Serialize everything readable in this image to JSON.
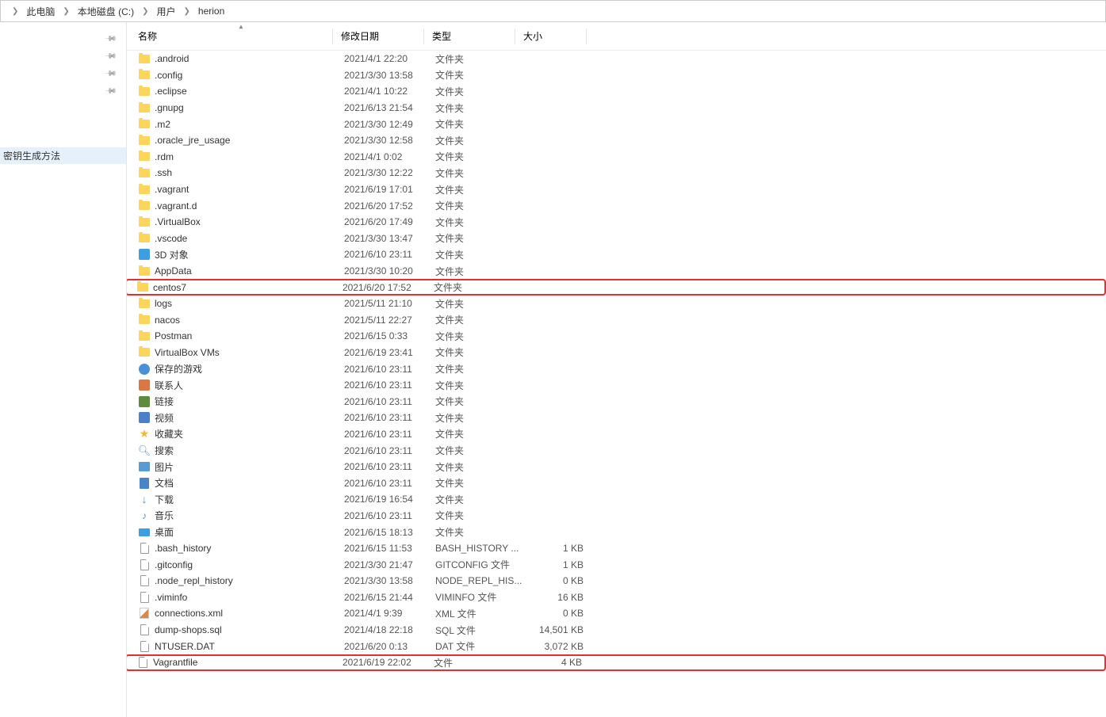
{
  "breadcrumb": [
    {
      "label": "此电脑"
    },
    {
      "label": "本地磁盘 (C:)"
    },
    {
      "label": "用户"
    },
    {
      "label": "herion"
    }
  ],
  "nav": {
    "pinned_count": 4,
    "selected_item": "密钥生成方法"
  },
  "columns": {
    "name": "名称",
    "date": "修改日期",
    "type": "类型",
    "size": "大小"
  },
  "files": [
    {
      "icon": "folder",
      "name": ".android",
      "date": "2021/4/1 22:20",
      "type": "文件夹",
      "size": ""
    },
    {
      "icon": "folder",
      "name": ".config",
      "date": "2021/3/30 13:58",
      "type": "文件夹",
      "size": ""
    },
    {
      "icon": "folder",
      "name": ".eclipse",
      "date": "2021/4/1 10:22",
      "type": "文件夹",
      "size": ""
    },
    {
      "icon": "folder",
      "name": ".gnupg",
      "date": "2021/6/13 21:54",
      "type": "文件夹",
      "size": ""
    },
    {
      "icon": "folder",
      "name": ".m2",
      "date": "2021/3/30 12:49",
      "type": "文件夹",
      "size": ""
    },
    {
      "icon": "folder",
      "name": ".oracle_jre_usage",
      "date": "2021/3/30 12:58",
      "type": "文件夹",
      "size": ""
    },
    {
      "icon": "folder",
      "name": ".rdm",
      "date": "2021/4/1 0:02",
      "type": "文件夹",
      "size": ""
    },
    {
      "icon": "folder",
      "name": ".ssh",
      "date": "2021/3/30 12:22",
      "type": "文件夹",
      "size": ""
    },
    {
      "icon": "folder",
      "name": ".vagrant",
      "date": "2021/6/19 17:01",
      "type": "文件夹",
      "size": ""
    },
    {
      "icon": "folder",
      "name": ".vagrant.d",
      "date": "2021/6/20 17:52",
      "type": "文件夹",
      "size": ""
    },
    {
      "icon": "folder",
      "name": ".VirtualBox",
      "date": "2021/6/20 17:49",
      "type": "文件夹",
      "size": ""
    },
    {
      "icon": "folder",
      "name": ".vscode",
      "date": "2021/3/30 13:47",
      "type": "文件夹",
      "size": ""
    },
    {
      "icon": "3d",
      "name": "3D 对象",
      "date": "2021/6/10 23:11",
      "type": "文件夹",
      "size": ""
    },
    {
      "icon": "folder",
      "name": "AppData",
      "date": "2021/3/30 10:20",
      "type": "文件夹",
      "size": ""
    },
    {
      "icon": "folder",
      "name": "centos7",
      "date": "2021/6/20 17:52",
      "type": "文件夹",
      "size": "",
      "highlighted": true
    },
    {
      "icon": "folder",
      "name": "logs",
      "date": "2021/5/11 21:10",
      "type": "文件夹",
      "size": ""
    },
    {
      "icon": "folder",
      "name": "nacos",
      "date": "2021/5/11 22:27",
      "type": "文件夹",
      "size": ""
    },
    {
      "icon": "folder",
      "name": "Postman",
      "date": "2021/6/15 0:33",
      "type": "文件夹",
      "size": ""
    },
    {
      "icon": "folder",
      "name": "VirtualBox VMs",
      "date": "2021/6/19 23:41",
      "type": "文件夹",
      "size": ""
    },
    {
      "icon": "game",
      "name": "保存的游戏",
      "date": "2021/6/10 23:11",
      "type": "文件夹",
      "size": ""
    },
    {
      "icon": "contacts",
      "name": "联系人",
      "date": "2021/6/10 23:11",
      "type": "文件夹",
      "size": ""
    },
    {
      "icon": "link",
      "name": "链接",
      "date": "2021/6/10 23:11",
      "type": "文件夹",
      "size": ""
    },
    {
      "icon": "video",
      "name": "视频",
      "date": "2021/6/10 23:11",
      "type": "文件夹",
      "size": ""
    },
    {
      "icon": "star",
      "name": "收藏夹",
      "date": "2021/6/10 23:11",
      "type": "文件夹",
      "size": ""
    },
    {
      "icon": "search",
      "name": "搜索",
      "date": "2021/6/10 23:11",
      "type": "文件夹",
      "size": ""
    },
    {
      "icon": "image",
      "name": "图片",
      "date": "2021/6/10 23:11",
      "type": "文件夹",
      "size": ""
    },
    {
      "icon": "doc",
      "name": "文档",
      "date": "2021/6/10 23:11",
      "type": "文件夹",
      "size": ""
    },
    {
      "icon": "download",
      "name": "下载",
      "date": "2021/6/19 16:54",
      "type": "文件夹",
      "size": ""
    },
    {
      "icon": "music",
      "name": "音乐",
      "date": "2021/6/10 23:11",
      "type": "文件夹",
      "size": ""
    },
    {
      "icon": "desktop",
      "name": "桌面",
      "date": "2021/6/15 18:13",
      "type": "文件夹",
      "size": ""
    },
    {
      "icon": "file",
      "name": ".bash_history",
      "date": "2021/6/15 11:53",
      "type": "BASH_HISTORY ...",
      "size": "1 KB"
    },
    {
      "icon": "file",
      "name": ".gitconfig",
      "date": "2021/3/30 21:47",
      "type": "GITCONFIG 文件",
      "size": "1 KB"
    },
    {
      "icon": "file",
      "name": ".node_repl_history",
      "date": "2021/3/30 13:58",
      "type": "NODE_REPL_HIS...",
      "size": "0 KB"
    },
    {
      "icon": "file",
      "name": ".viminfo",
      "date": "2021/6/15 21:44",
      "type": "VIMINFO 文件",
      "size": "16 KB"
    },
    {
      "icon": "xml",
      "name": "connections.xml",
      "date": "2021/4/1 9:39",
      "type": "XML 文件",
      "size": "0 KB"
    },
    {
      "icon": "file",
      "name": "dump-shops.sql",
      "date": "2021/4/18 22:18",
      "type": "SQL 文件",
      "size": "14,501 KB"
    },
    {
      "icon": "file",
      "name": "NTUSER.DAT",
      "date": "2021/6/20 0:13",
      "type": "DAT 文件",
      "size": "3,072 KB"
    },
    {
      "icon": "file",
      "name": "Vagrantfile",
      "date": "2021/6/19 22:02",
      "type": "文件",
      "size": "4 KB",
      "highlighted": true
    }
  ]
}
